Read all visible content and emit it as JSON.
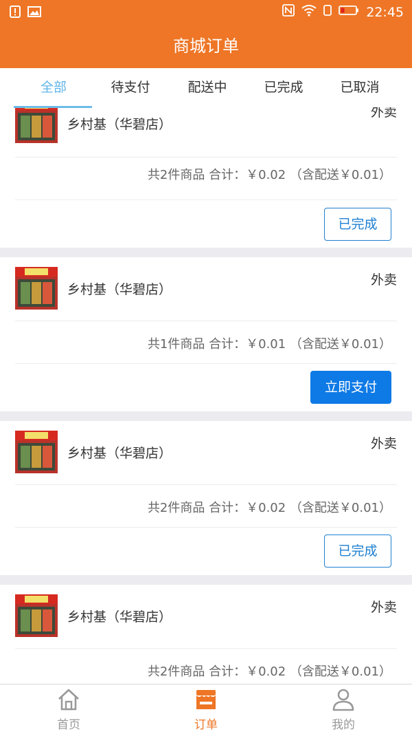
{
  "status_bar": {
    "time": "22:45"
  },
  "header": {
    "title": "商城订单"
  },
  "tabs": [
    {
      "label": "全部",
      "active": true
    },
    {
      "label": "待支付",
      "active": false
    },
    {
      "label": "配送中",
      "active": false
    },
    {
      "label": "已完成",
      "active": false
    },
    {
      "label": "已取消",
      "active": false
    }
  ],
  "orders": [
    {
      "store": "乡村基（华碧店）",
      "type": "外卖",
      "summary": "共2件商品 合计：￥0.02 （含配送￥0.01）",
      "action": "已完成",
      "action_style": "outline"
    },
    {
      "store": "乡村基（华碧店）",
      "type": "外卖",
      "summary": "共1件商品 合计：￥0.01 （含配送￥0.01）",
      "action": "立即支付",
      "action_style": "filled"
    },
    {
      "store": "乡村基（华碧店）",
      "type": "外卖",
      "summary": "共2件商品 合计：￥0.02 （含配送￥0.01）",
      "action": "已完成",
      "action_style": "outline"
    },
    {
      "store": "乡村基（华碧店）",
      "type": "外卖",
      "summary": "共2件商品 合计：￥0.02 （含配送￥0.01）",
      "action": "",
      "action_style": "none"
    }
  ],
  "bottom_nav": [
    {
      "label": "首页",
      "icon": "home-icon",
      "active": false
    },
    {
      "label": "订单",
      "icon": "shop-icon",
      "active": true
    },
    {
      "label": "我的",
      "icon": "person-icon",
      "active": false
    }
  ],
  "colors": {
    "brand": "#ee7626",
    "tab_active": "#5fb5e8",
    "button_blue": "#0e7ae6"
  }
}
